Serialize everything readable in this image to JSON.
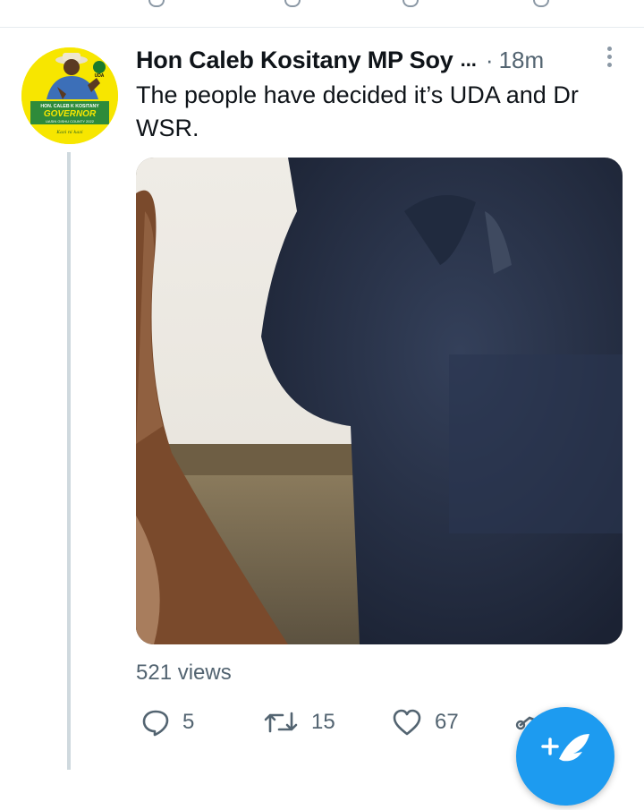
{
  "tweet": {
    "author_name": "Hon Caleb Kositany MP Soy",
    "name_truncation": "...",
    "separator": "·",
    "timestamp": "18m",
    "text": "The people have decided it’s UDA and Dr WSR.",
    "views": "521 views"
  },
  "avatar": {
    "party": "UDA",
    "banner_name": "HON. CALEB K KOSITANY",
    "banner_title": "GOVERNOR",
    "banner_county": "UASIN GISHU COUNTY 2022",
    "slogan": "Kazi ni kazi"
  },
  "actions": {
    "replies": "5",
    "retweets": "15",
    "likes": "67"
  },
  "icons": {
    "reply": "reply-icon",
    "retweet": "retweet-icon",
    "like": "heart-icon",
    "share": "share-icon",
    "more": "more-vertical-icon",
    "compose": "compose-tweet-icon"
  },
  "colors": {
    "accent": "#1d9bf0",
    "secondary_text": "#536471",
    "avatar_background": "#f7e600",
    "avatar_banner": "#2e8b3a"
  }
}
